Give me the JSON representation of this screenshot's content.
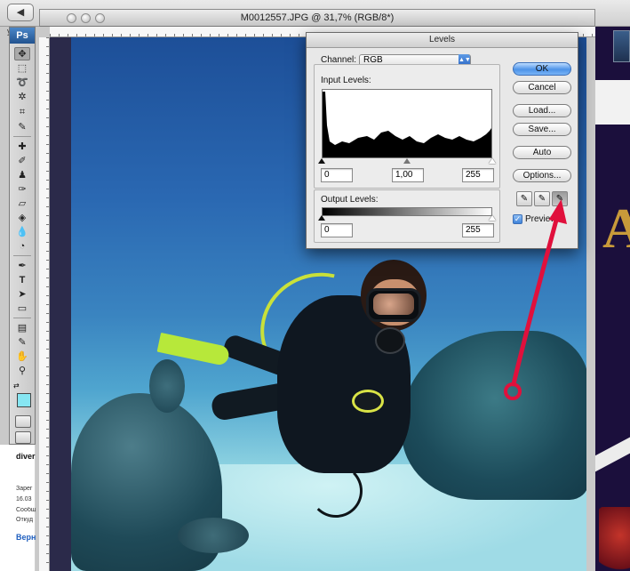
{
  "browser": {
    "back_label": "◀",
    "strip_text": "у"
  },
  "document": {
    "title": "M0012557.JPG @ 31,7% (RGB/8*)"
  },
  "tools_panel": {
    "logo": "Ps"
  },
  "levels_dialog": {
    "title": "Levels",
    "channel_label": "Channel:",
    "channel_value": "RGB",
    "input_levels_label": "Input Levels:",
    "input_black": "0",
    "input_gamma": "1,00",
    "input_white": "255",
    "output_levels_label": "Output Levels:",
    "output_black": "0",
    "output_white": "255",
    "buttons": {
      "ok": "OK",
      "cancel": "Cancel",
      "load": "Load...",
      "save": "Save...",
      "auto": "Auto",
      "options": "Options..."
    },
    "preview_label": "Preview",
    "preview_checked": true
  },
  "web_page_left": {
    "line1": "diver",
    "line2": "Зарег",
    "line3": "16.03",
    "line4": "Сообщ",
    "line5": "Откуд",
    "link": "Верн"
  },
  "colors": {
    "foreground": "#86e6f2",
    "annotation": "#e0103c",
    "ok_button": "#4d93e8"
  },
  "icons": [
    "back-arrow-icon",
    "move-icon",
    "marquee-icon",
    "lasso-icon",
    "magic-wand-icon",
    "crop-icon",
    "eyedropper-icon",
    "healing-icon",
    "brush-icon",
    "stamp-icon",
    "history-brush-icon",
    "eraser-icon",
    "paint-bucket-icon",
    "blur-icon",
    "dodge-icon",
    "pen-icon",
    "type-icon",
    "path-select-icon",
    "shape-icon",
    "notes-icon",
    "hand-icon",
    "zoom-icon",
    "black-eyedropper-icon",
    "gray-eyedropper-icon",
    "white-eyedropper-icon"
  ]
}
